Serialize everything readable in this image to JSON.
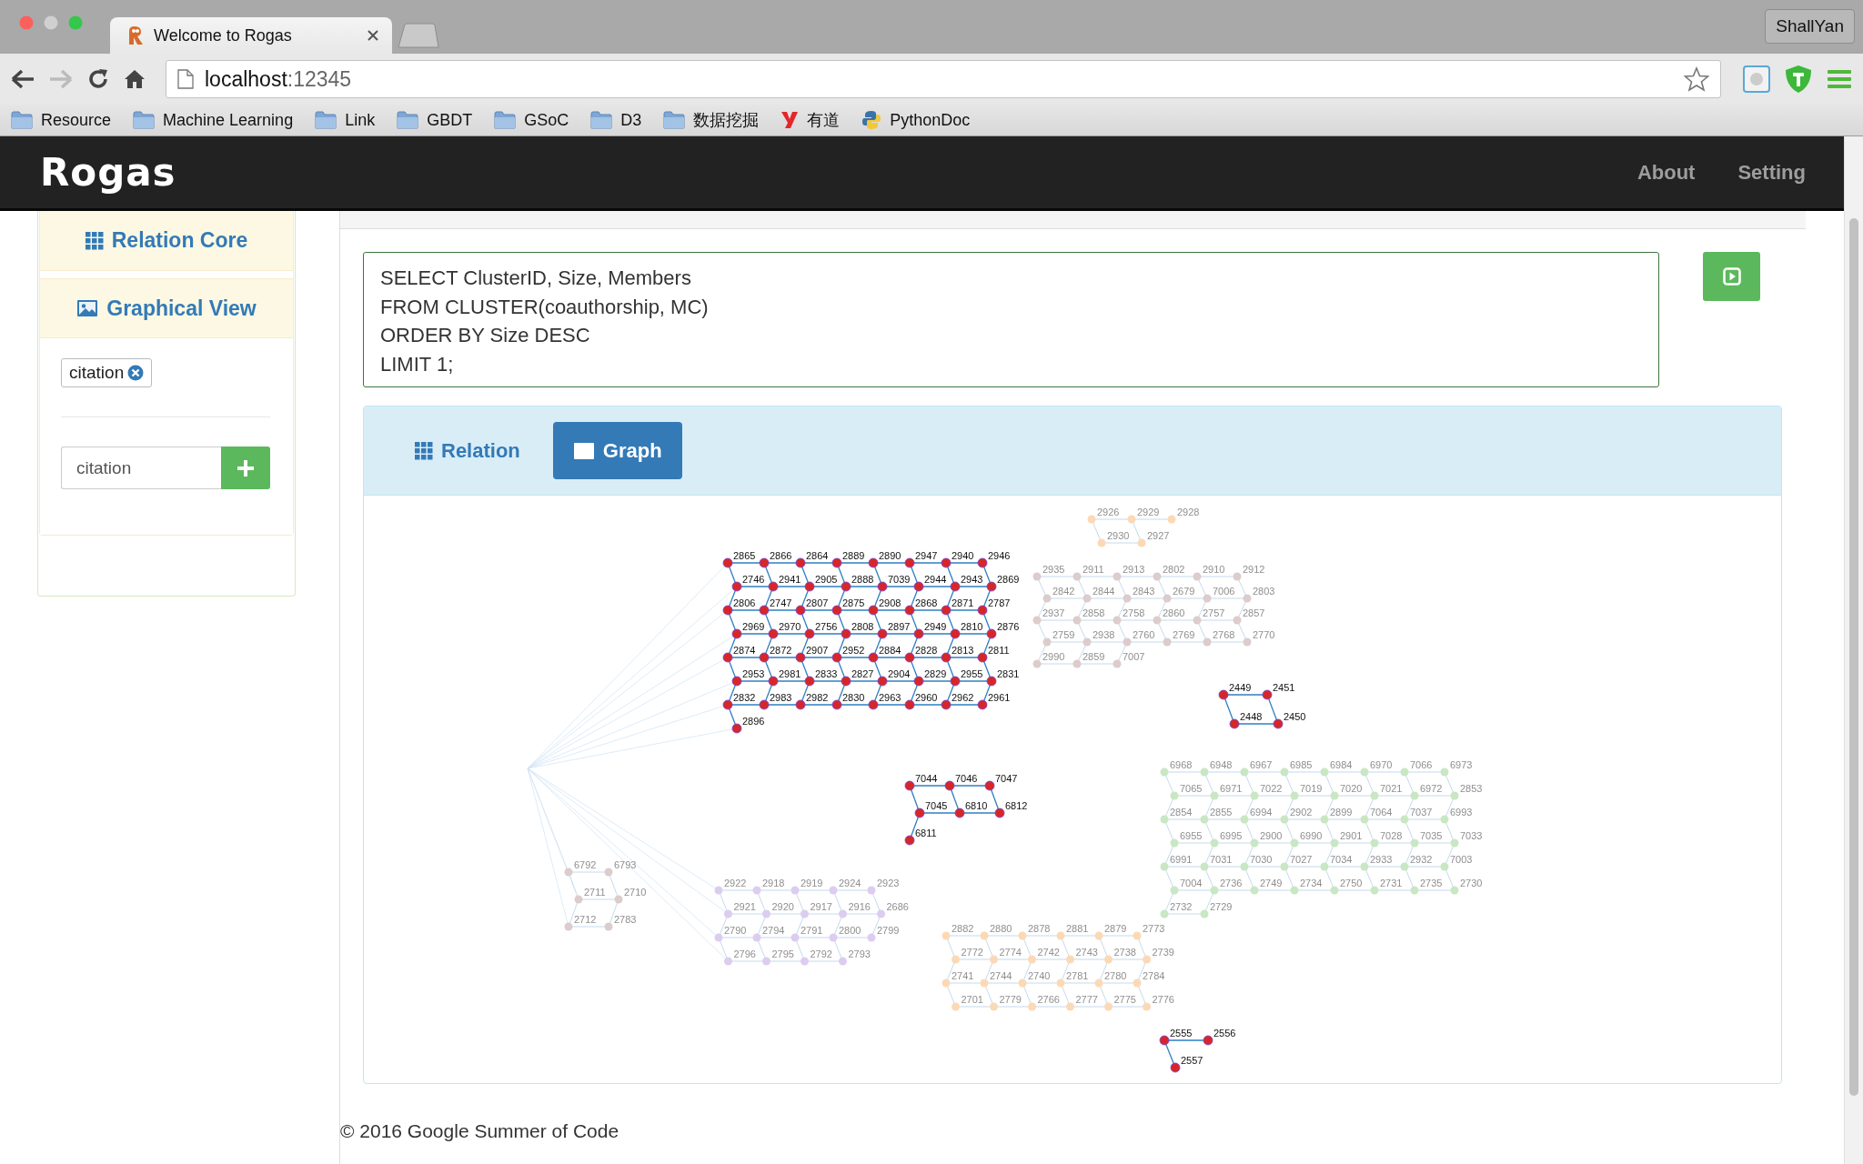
{
  "browser": {
    "tab": {
      "title": "Welcome to Rogas"
    },
    "user": "ShallYan",
    "address": {
      "host": "localhost",
      "port": ":12345"
    },
    "bookmarks": [
      {
        "label": "Resource",
        "kind": "folder"
      },
      {
        "label": "Machine Learning",
        "kind": "folder"
      },
      {
        "label": "Link",
        "kind": "folder"
      },
      {
        "label": "GBDT",
        "kind": "folder"
      },
      {
        "label": "GSoC",
        "kind": "folder"
      },
      {
        "label": "D3",
        "kind": "folder"
      },
      {
        "label": "数据挖掘",
        "kind": "folder"
      },
      {
        "label": "有道",
        "kind": "youdao"
      },
      {
        "label": "PythonDoc",
        "kind": "python"
      }
    ]
  },
  "navbar": {
    "logo": "Rogas",
    "links": [
      "About",
      "Setting"
    ]
  },
  "sidebar": {
    "sections": [
      {
        "title": "Relation Core"
      },
      {
        "title": "Graphical View"
      }
    ],
    "tags": [
      "citation"
    ],
    "input": {
      "value": "citation"
    }
  },
  "query": {
    "value": "SELECT ClusterID, Size, Members\nFROM CLUSTER(coauthorship, MC)\nORDER BY Size DESC\nLIMIT 1;"
  },
  "results": {
    "tabs": [
      {
        "label": "Relation",
        "selected": false
      },
      {
        "label": "Graph",
        "selected": true
      }
    ],
    "graph": {
      "clusters": [
        {
          "color": "#d62728",
          "highlighted": true,
          "nodes": [
            "2865",
            "2866",
            "2864",
            "2889",
            "2890",
            "2947",
            "2940",
            "2946",
            "2746",
            "2941",
            "2905",
            "2888",
            "7039",
            "2944",
            "2943",
            "2869",
            "2806",
            "2747",
            "2807",
            "2875",
            "2908",
            "2868",
            "2871",
            "2787",
            "2969",
            "2970",
            "2756",
            "2808",
            "2897",
            "2949",
            "2810",
            "2876",
            "2874",
            "2872",
            "2907",
            "2952",
            "2884",
            "2828",
            "2813",
            "2811",
            "2953",
            "2981",
            "2833",
            "2827",
            "2904",
            "2829",
            "2955",
            "2831",
            "2832",
            "2983",
            "2982",
            "2830",
            "2963",
            "2960",
            "2962",
            "2961",
            "2896"
          ]
        },
        {
          "color": "#d62728",
          "highlighted": true,
          "nodes": [
            "7044",
            "7046",
            "7047",
            "7045",
            "6810",
            "6812",
            "6811"
          ]
        },
        {
          "color": "#d62728",
          "highlighted": true,
          "nodes": [
            "2449",
            "2451",
            "2448",
            "2450"
          ]
        },
        {
          "color": "#d62728",
          "highlighted": true,
          "nodes": [
            "2555",
            "2556",
            "2557"
          ]
        },
        {
          "color": "#dccdf0",
          "highlighted": false,
          "nodes": [
            "2922",
            "2918",
            "2919",
            "2924",
            "2923",
            "2921",
            "2920",
            "2917",
            "2916",
            "2686",
            "2790",
            "2794",
            "2791",
            "2800",
            "2799",
            "2796",
            "2795",
            "2792",
            "2793"
          ]
        },
        {
          "color": "#ddcccc",
          "highlighted": false,
          "nodes": [
            "6792",
            "6793",
            "2711",
            "2710",
            "2712",
            "2783"
          ]
        },
        {
          "color": "#fcd9b5",
          "highlighted": false,
          "nodes": [
            "2926",
            "2929",
            "2928",
            "2930",
            "2927"
          ]
        },
        {
          "color": "#ddcccc",
          "highlighted": false,
          "nodes": [
            "2935",
            "2911",
            "2913",
            "2802",
            "2910",
            "2912",
            "2842",
            "2844",
            "2843",
            "2679",
            "7006",
            "2803",
            "2937",
            "2858",
            "2758",
            "2860",
            "2757",
            "2857",
            "2759",
            "2938",
            "2760",
            "2769",
            "2768",
            "2770",
            "2990",
            "2859",
            "7007"
          ]
        },
        {
          "color": "#fcd9b5",
          "highlighted": false,
          "nodes": [
            "2882",
            "2880",
            "2878",
            "2881",
            "2879",
            "2773",
            "2772",
            "2774",
            "2742",
            "2743",
            "2738",
            "2739",
            "2741",
            "2744",
            "2740",
            "2781",
            "2780",
            "2784",
            "2701",
            "2779",
            "2766",
            "2777",
            "2775",
            "2776"
          ]
        },
        {
          "color": "#c8e7c2",
          "highlighted": false,
          "nodes": [
            "6968",
            "6948",
            "6967",
            "6985",
            "6984",
            "6970",
            "7066",
            "6973",
            "7065",
            "6971",
            "7022",
            "7019",
            "7020",
            "7021",
            "6972",
            "2853",
            "2854",
            "2855",
            "6994",
            "2902",
            "2899",
            "7064",
            "7037",
            "6993",
            "6955",
            "6995",
            "2900",
            "6990",
            "2901",
            "7028",
            "7035",
            "7033",
            "6991",
            "7031",
            "7030",
            "7027",
            "7034",
            "2933",
            "2932",
            "7003",
            "7004",
            "2736",
            "2749",
            "2734",
            "2750",
            "2731",
            "2735",
            "2730",
            "2732",
            "2729"
          ]
        }
      ]
    }
  },
  "footer": "© 2016 Google Summer of Code"
}
